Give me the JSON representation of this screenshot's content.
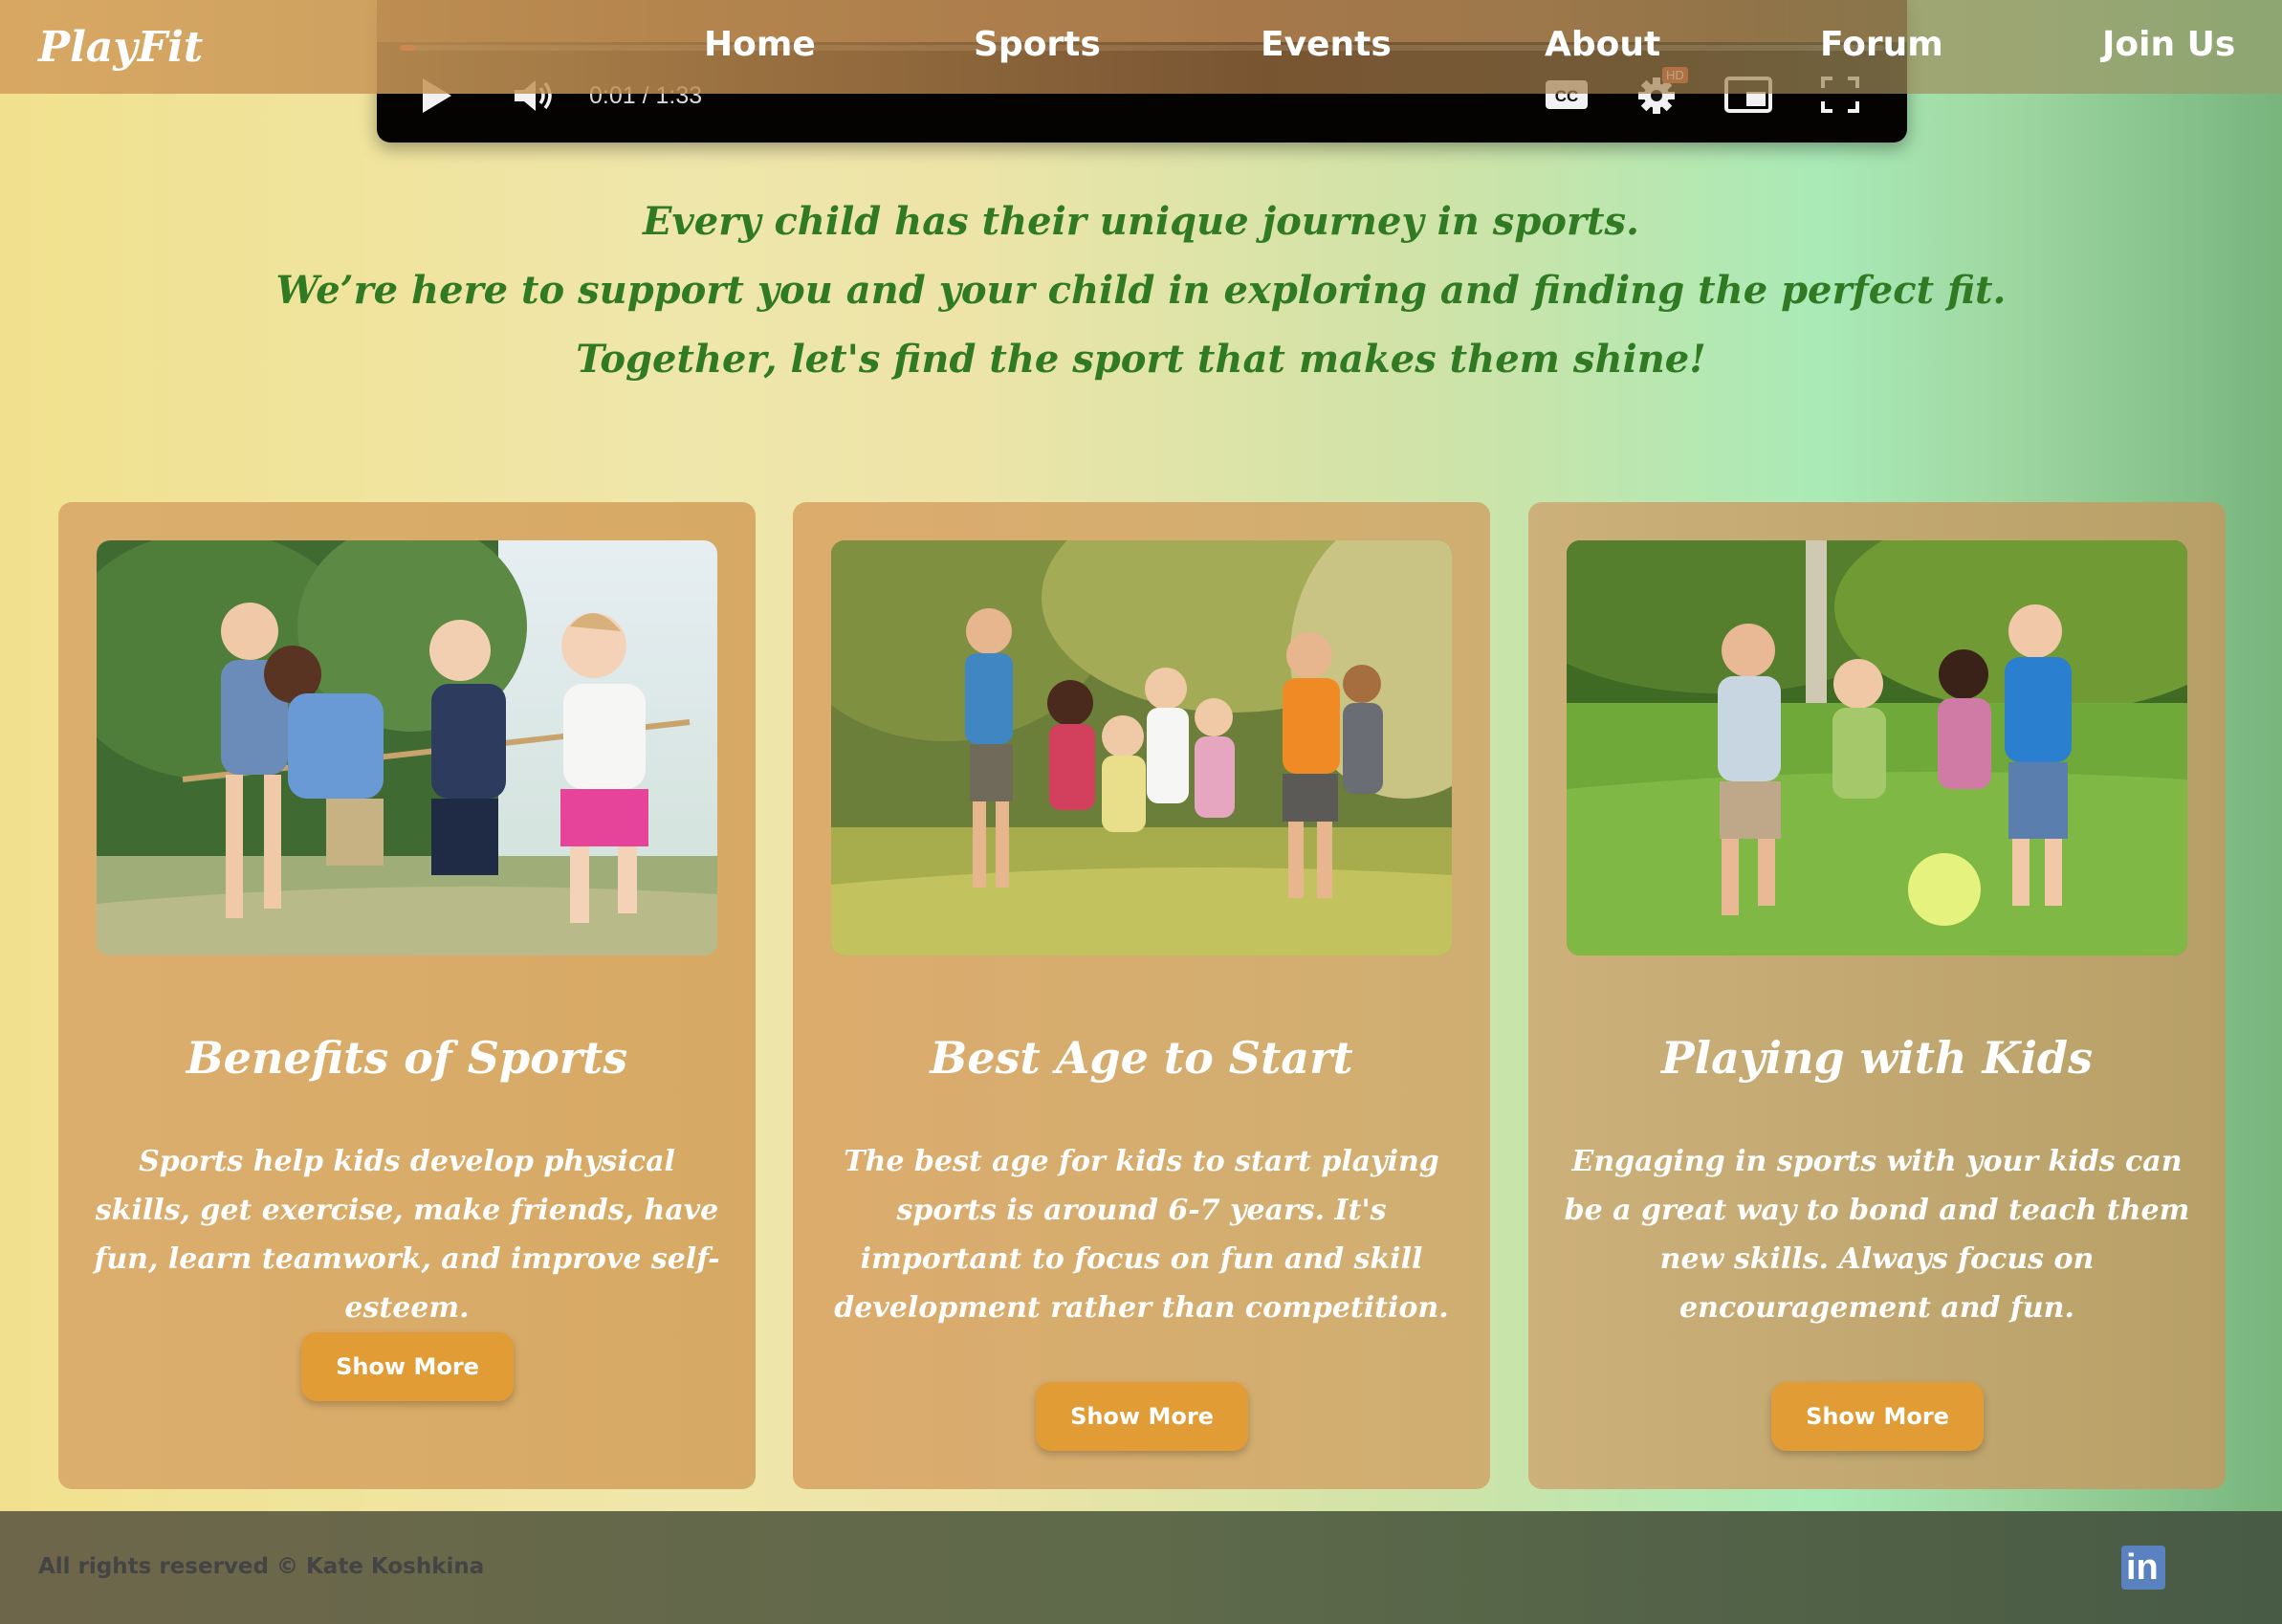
{
  "nav": {
    "logo": "PlayFit",
    "items": [
      "Home",
      "Sports",
      "Events",
      "About",
      "Forum",
      "Join Us"
    ]
  },
  "video": {
    "time": "0:01 / 1:33",
    "progress": 0.011,
    "hd_label": "HD",
    "cc_label": "CC"
  },
  "intro": {
    "line1": "Every child has their unique journey in sports.",
    "line2": "We’re here to support you and your child in exploring and finding the perfect fit.",
    "line3": "Together, let's find the sport that makes them shine!"
  },
  "cards": [
    {
      "title": "Benefits of Sports",
      "text": "Sports help kids develop physical skills, get exercise, make friends, have fun, learn teamwork, and improve self-esteem.",
      "button": "Show More"
    },
    {
      "title": "Best Age to Start",
      "text": "The best age for kids to start playing sports is around 6-7 years. It's important to focus on fun and skill development rather than competition.",
      "button": "Show More"
    },
    {
      "title": "Playing with Kids",
      "text": "Engaging in sports with your kids can be a great way to bond and teach them new skills. Always focus on encouragement and fun.",
      "button": "Show More"
    }
  ],
  "footer": {
    "copyright": "All rights reserved © Kate Koshkina",
    "social_icon": "linkedin-icon"
  },
  "colors": {
    "intro_text": "#2f7a22",
    "button": "#e29c36",
    "progress": "#e52d27"
  }
}
